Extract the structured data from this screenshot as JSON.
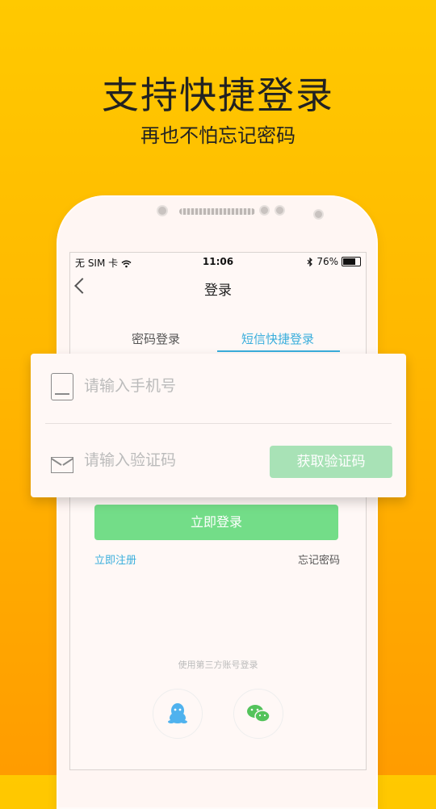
{
  "promo": {
    "headline": "支持快捷登录",
    "subline": "再也不怕忘记密码"
  },
  "status_bar": {
    "carrier": "无 SIM 卡",
    "time": "11:06",
    "battery": "76%"
  },
  "nav": {
    "title": "登录"
  },
  "tabs": [
    {
      "label": "密码登录",
      "active": false
    },
    {
      "label": "短信快捷登录",
      "active": true
    }
  ],
  "form": {
    "phone_placeholder": "请输入手机号",
    "code_placeholder": "请输入验证码",
    "get_code_label": "获取验证码",
    "login_label": "立即登录",
    "register_label": "立即注册",
    "forgot_label": "忘记密码"
  },
  "third_party": {
    "label": "使用第三方账号登录",
    "providers": [
      "qq-icon",
      "wechat-icon"
    ]
  },
  "colors": {
    "accent_blue": "#3aaedc",
    "button_green": "#73dd88",
    "button_green_disabled": "#a8e2b6",
    "background_yellow": "#ffc900"
  }
}
